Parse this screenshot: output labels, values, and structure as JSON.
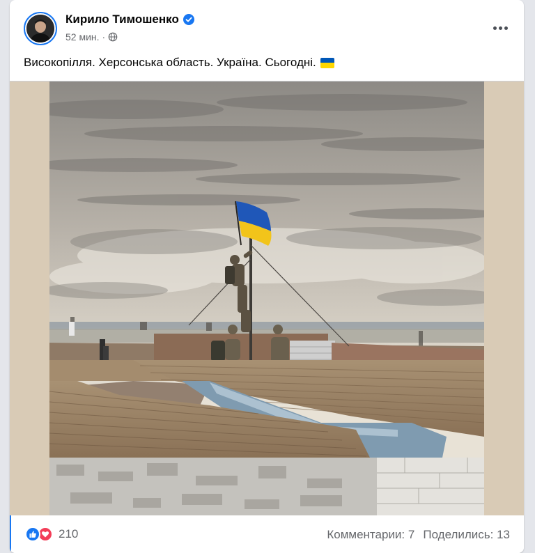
{
  "post": {
    "author": "Кирило Тимошенко",
    "time": "52 мин.",
    "separator": "·",
    "text": "Високопілля. Херсонська область. Україна. Сьогодні."
  },
  "icons": {
    "verified": "verified-badge-icon",
    "audience": "globe-icon",
    "more": "more-options-icon",
    "flag": "ukraine-flag-emoji",
    "like": "like-reaction-icon",
    "love": "love-reaction-icon"
  },
  "colors": {
    "accent": "#1877f2",
    "love": "#f33e58",
    "flag_blue": "#0057b7",
    "flag_yellow": "#ffd700"
  },
  "footer": {
    "reactions_count": "210",
    "comments": "Комментарии: 7",
    "shares": "Поделились: 13"
  }
}
